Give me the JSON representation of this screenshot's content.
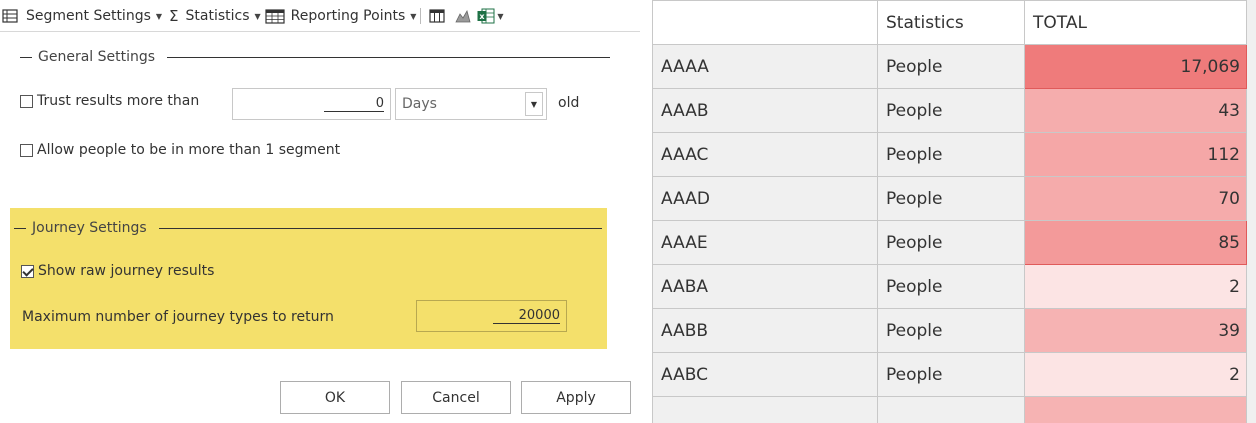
{
  "toolbar": {
    "segment_settings": "Segment Settings",
    "statistics": "Statistics",
    "reporting_points": "Reporting Points",
    "sigma_glyph": "Σ"
  },
  "general": {
    "title": "General Settings",
    "trust_label": "Trust results more than",
    "trust_value": "0",
    "trust_unit": "Days",
    "trust_suffix": "old",
    "allow_label": "Allow people to be in more than 1 segment"
  },
  "journey": {
    "title": "Journey Settings",
    "show_raw_label": "Show raw journey results",
    "max_label": "Maximum number of journey types to return",
    "max_value": "20000",
    "highlight_color": "#f4e06b"
  },
  "buttons": {
    "ok": "OK",
    "cancel": "Cancel",
    "apply": "Apply"
  },
  "table": {
    "headers": [
      "",
      "Statistics",
      "TOTAL"
    ],
    "rows": [
      {
        "segment": "AAAA",
        "statistic": "People",
        "total": "17,069",
        "level": 1.0
      },
      {
        "segment": "AAAB",
        "statistic": "People",
        "total": "43",
        "level": 0.55
      },
      {
        "segment": "AAAC",
        "statistic": "People",
        "total": "112",
        "level": 0.6
      },
      {
        "segment": "AAAD",
        "statistic": "People",
        "total": "70",
        "level": 0.57
      },
      {
        "segment": "AAAE",
        "statistic": "People",
        "total": "85",
        "level": 0.72
      },
      {
        "segment": "AABA",
        "statistic": "People",
        "total": "2",
        "level": 0.05
      },
      {
        "segment": "AABB",
        "statistic": "People",
        "total": "39",
        "level": 0.5
      },
      {
        "segment": "AABC",
        "statistic": "People",
        "total": "2",
        "level": 0.05
      }
    ],
    "heat_color": "#ef7b7b"
  }
}
